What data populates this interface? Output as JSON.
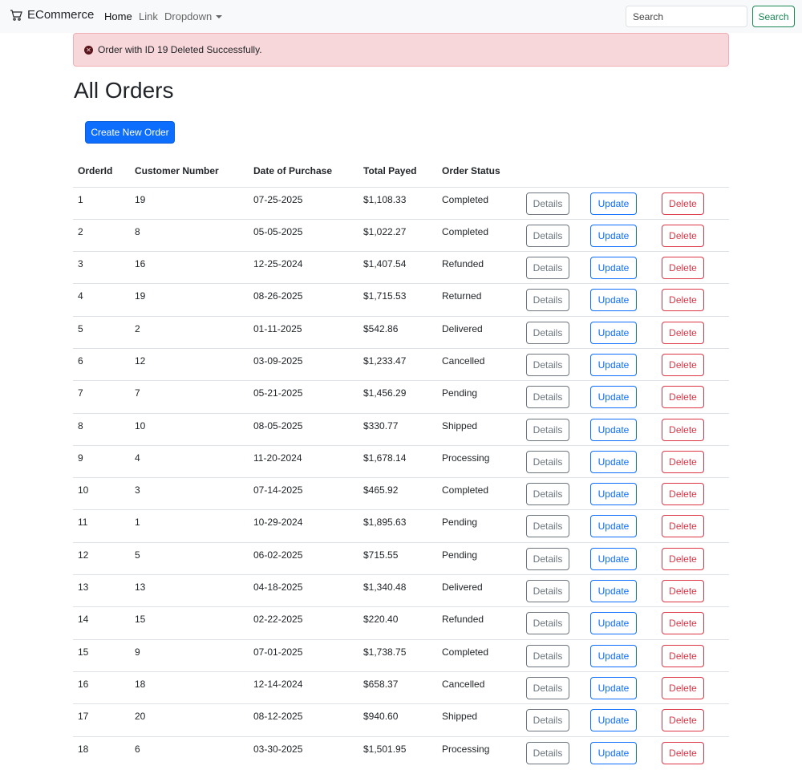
{
  "navbar": {
    "brand": "ECommerce",
    "links": [
      "Home",
      "Link",
      "Dropdown"
    ],
    "search_placeholder": "Search",
    "search_button": "Search"
  },
  "alert": {
    "message": "Order with ID 19 Deleted Successfully."
  },
  "page": {
    "title": "All Orders",
    "create_button": "Create New Order"
  },
  "table": {
    "headers": [
      "OrderId",
      "Customer Number",
      "Date of Purchase",
      "Total Payed",
      "Order Status"
    ],
    "actions": {
      "details": "Details",
      "update": "Update",
      "delete": "Delete"
    },
    "rows": [
      [
        "1",
        "19",
        "07-25-2025",
        "$1,108.33",
        "Completed"
      ],
      [
        "2",
        "8",
        "05-05-2025",
        "$1,022.27",
        "Completed"
      ],
      [
        "3",
        "16",
        "12-25-2024",
        "$1,407.54",
        "Refunded"
      ],
      [
        "4",
        "19",
        "08-26-2025",
        "$1,715.53",
        "Returned"
      ],
      [
        "5",
        "2",
        "01-11-2025",
        "$542.86",
        "Delivered"
      ],
      [
        "6",
        "12",
        "03-09-2025",
        "$1,233.47",
        "Cancelled"
      ],
      [
        "7",
        "7",
        "05-21-2025",
        "$1,456.29",
        "Pending"
      ],
      [
        "8",
        "10",
        "08-05-2025",
        "$330.77",
        "Shipped"
      ],
      [
        "9",
        "4",
        "11-20-2024",
        "$1,678.14",
        "Processing"
      ],
      [
        "10",
        "3",
        "07-14-2025",
        "$465.92",
        "Completed"
      ],
      [
        "11",
        "1",
        "10-29-2024",
        "$1,895.63",
        "Pending"
      ],
      [
        "12",
        "5",
        "06-02-2025",
        "$715.55",
        "Pending"
      ],
      [
        "13",
        "13",
        "04-18-2025",
        "$1,340.48",
        "Delivered"
      ],
      [
        "14",
        "15",
        "02-22-2025",
        "$220.40",
        "Refunded"
      ],
      [
        "15",
        "9",
        "07-01-2025",
        "$1,738.75",
        "Completed"
      ],
      [
        "16",
        "18",
        "12-14-2024",
        "$658.37",
        "Cancelled"
      ],
      [
        "17",
        "20",
        "08-12-2025",
        "$940.60",
        "Shipped"
      ],
      [
        "18",
        "6",
        "03-30-2025",
        "$1,501.95",
        "Processing"
      ]
    ]
  },
  "colors": {
    "primary": "#0d6efd",
    "danger": "#dc3545",
    "secondary": "#6c757d",
    "success": "#198754",
    "alert_bg": "#f8d7da"
  }
}
